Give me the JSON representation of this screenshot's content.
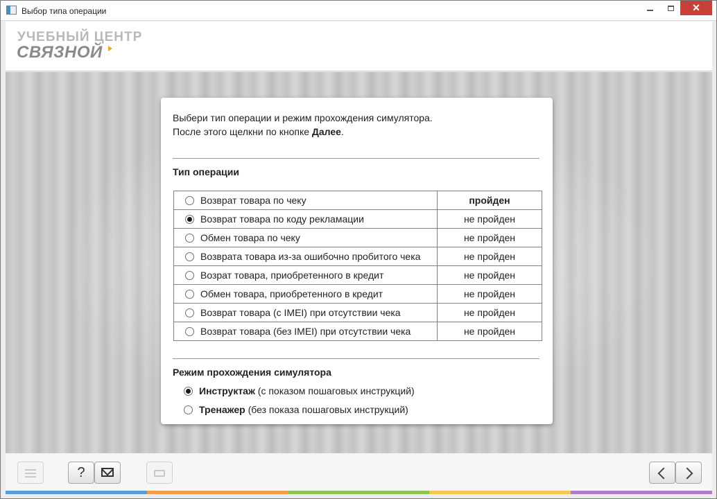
{
  "window": {
    "title": "Выбор типа операции",
    "close_glyph": "✕"
  },
  "logo": {
    "line1": "УЧЕБНЫЙ ЦЕНТР",
    "line2": "СВЯЗНОЙ"
  },
  "dialog": {
    "intro_line1": "Выбери тип операции и режим прохождения симулятора.",
    "intro_line2_prefix": "После этого щелкни по кнопке ",
    "intro_line2_bold": "Далее",
    "intro_line2_suffix": ".",
    "operations_title": "Тип операции",
    "operations": [
      {
        "label": "Возврат товара по чеку",
        "status": "пройден",
        "selected": false
      },
      {
        "label": "Возврат товара по коду рекламации",
        "status": "не пройден",
        "selected": true
      },
      {
        "label": "Обмен товара по чеку",
        "status": "не пройден",
        "selected": false
      },
      {
        "label": "Возврата товара из-за ошибочно пробитого чека",
        "status": "не пройден",
        "selected": false
      },
      {
        "label": "Возрат товара, приобретенного в кредит",
        "status": "не пройден",
        "selected": false
      },
      {
        "label": "Обмен товара, приобретенного в кредит",
        "status": "не пройден",
        "selected": false
      },
      {
        "label": "Возврат товара (с IMEI) при отсутствии чека",
        "status": "не пройден",
        "selected": false
      },
      {
        "label": "Возврат товара (без IMEI) при отсутствии чека",
        "status": "не пройден",
        "selected": false
      }
    ],
    "mode_title": "Режим прохождения симулятора",
    "modes": [
      {
        "name": "Инструктаж",
        "desc": " (с показом пошаговых инструкций)",
        "selected": true
      },
      {
        "name": "Тренажер",
        "desc": " (без показа пошаговых инструкций)",
        "selected": false
      }
    ]
  },
  "toolbar": {
    "menu_icon": "menu-icon",
    "help_label": "?",
    "mail_icon": "envelope-icon",
    "print_icon": "printer-icon",
    "back_icon": "chevron-left-icon",
    "next_icon": "chevron-right-icon"
  },
  "colors": {
    "accent_strip": [
      "#5b9bd5",
      "#f39c4a",
      "#8dc455",
      "#f2c94c",
      "#b07cc6"
    ],
    "logo_spark": "#f1a52a",
    "close_button": "#c7413a"
  }
}
